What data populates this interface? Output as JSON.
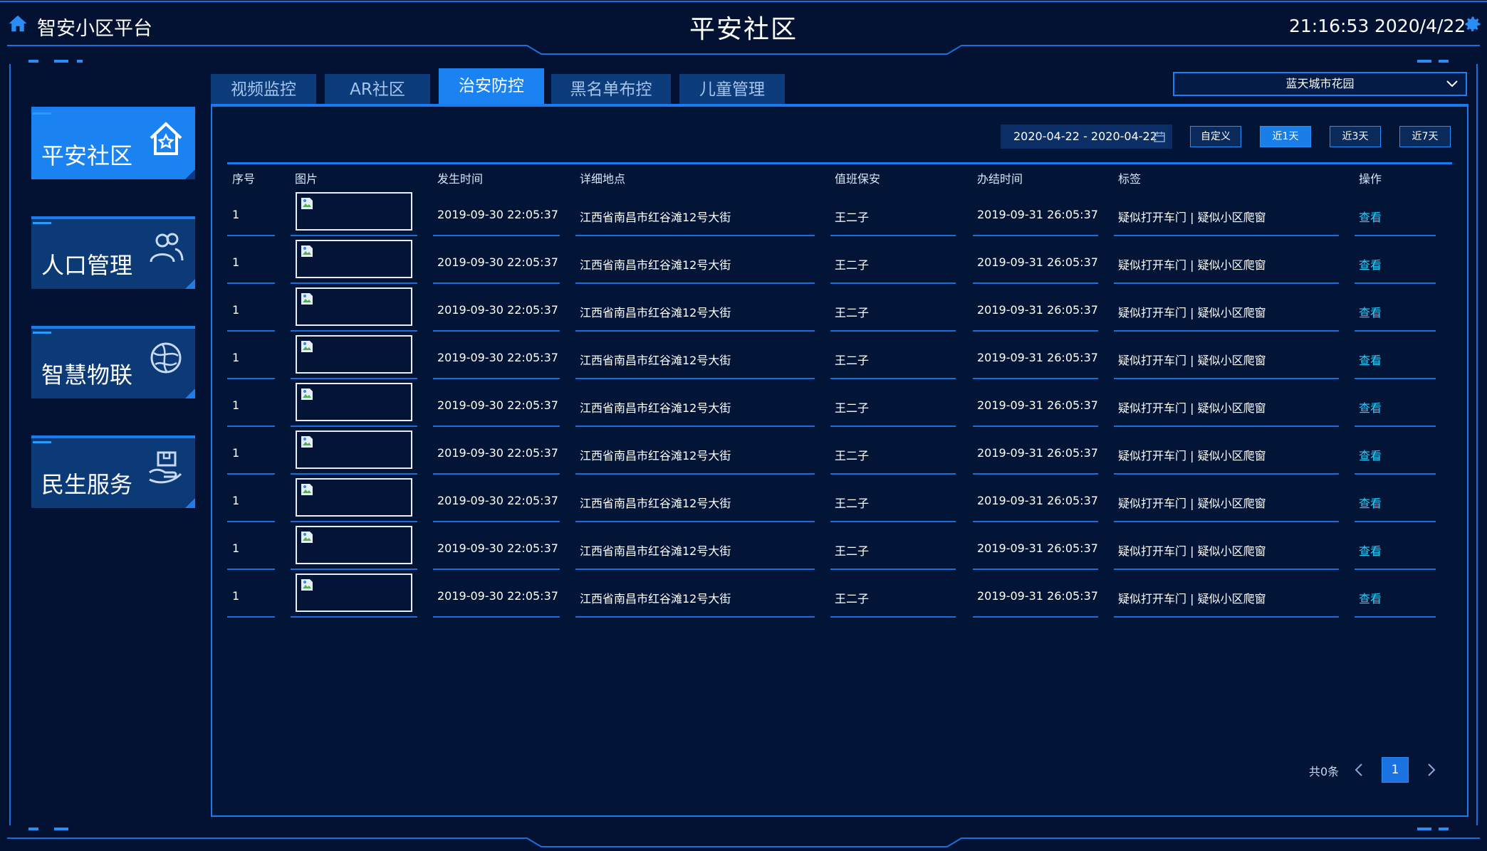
{
  "header": {
    "app_title": "智安小区平台",
    "center_title": "平安社区",
    "time": "21:16:53",
    "date": "2020/4/22"
  },
  "sidebar": {
    "items": [
      {
        "label": "平安社区",
        "icon": "house-star-icon",
        "active": true
      },
      {
        "label": "人口管理",
        "icon": "users-icon",
        "active": false
      },
      {
        "label": "智慧物联",
        "icon": "globe-icon",
        "active": false
      },
      {
        "label": "民生服务",
        "icon": "hand-box-icon",
        "active": false
      }
    ]
  },
  "tabs": [
    {
      "label": "视频监控",
      "active": false
    },
    {
      "label": "AR社区",
      "active": false
    },
    {
      "label": "治安防控",
      "active": true
    },
    {
      "label": "黑名单布控",
      "active": false
    },
    {
      "label": "儿童管理",
      "active": false
    }
  ],
  "community_select": {
    "value": "蓝天城市花园"
  },
  "filters": {
    "date_range": "2020-04-22 - 2020-04-22",
    "buttons": [
      {
        "label": "自定义",
        "active": false
      },
      {
        "label": "近1天",
        "active": true
      },
      {
        "label": "近3天",
        "active": false
      },
      {
        "label": "近7天",
        "active": false
      }
    ]
  },
  "table": {
    "headers": [
      "序号",
      "图片",
      "发生时间",
      "详细地点",
      "值班保安",
      "办结时间",
      "标签",
      "操作"
    ],
    "rows": [
      {
        "no": "1",
        "occur": "2019-09-30 22:05:37",
        "place": "江西省南昌市红谷滩12号大街",
        "guard": "王二子",
        "done": "2019-09-31 26:05:37",
        "tag": "疑似打开车门 | 疑似小区爬窗",
        "action": "查看"
      },
      {
        "no": "1",
        "occur": "2019-09-30 22:05:37",
        "place": "江西省南昌市红谷滩12号大街",
        "guard": "王二子",
        "done": "2019-09-31 26:05:37",
        "tag": "疑似打开车门 | 疑似小区爬窗",
        "action": "查看"
      },
      {
        "no": "1",
        "occur": "2019-09-30 22:05:37",
        "place": "江西省南昌市红谷滩12号大街",
        "guard": "王二子",
        "done": "2019-09-31 26:05:37",
        "tag": "疑似打开车门 | 疑似小区爬窗",
        "action": "查看"
      },
      {
        "no": "1",
        "occur": "2019-09-30 22:05:37",
        "place": "江西省南昌市红谷滩12号大街",
        "guard": "王二子",
        "done": "2019-09-31 26:05:37",
        "tag": "疑似打开车门 | 疑似小区爬窗",
        "action": "查看"
      },
      {
        "no": "1",
        "occur": "2019-09-30 22:05:37",
        "place": "江西省南昌市红谷滩12号大街",
        "guard": "王二子",
        "done": "2019-09-31 26:05:37",
        "tag": "疑似打开车门 | 疑似小区爬窗",
        "action": "查看"
      },
      {
        "no": "1",
        "occur": "2019-09-30 22:05:37",
        "place": "江西省南昌市红谷滩12号大街",
        "guard": "王二子",
        "done": "2019-09-31 26:05:37",
        "tag": "疑似打开车门 | 疑似小区爬窗",
        "action": "查看"
      },
      {
        "no": "1",
        "occur": "2019-09-30 22:05:37",
        "place": "江西省南昌市红谷滩12号大街",
        "guard": "王二子",
        "done": "2019-09-31 26:05:37",
        "tag": "疑似打开车门 | 疑似小区爬窗",
        "action": "查看"
      },
      {
        "no": "1",
        "occur": "2019-09-30 22:05:37",
        "place": "江西省南昌市红谷滩12号大街",
        "guard": "王二子",
        "done": "2019-09-31 26:05:37",
        "tag": "疑似打开车门 | 疑似小区爬窗",
        "action": "查看"
      },
      {
        "no": "1",
        "occur": "2019-09-30 22:05:37",
        "place": "江西省南昌市红谷滩12号大街",
        "guard": "王二子",
        "done": "2019-09-31 26:05:37",
        "tag": "疑似打开车门 | 疑似小区爬窗",
        "action": "查看"
      }
    ]
  },
  "pagination": {
    "total": "共0条",
    "current": "1"
  },
  "colors": {
    "accent": "#1a82f1",
    "background": "#031233",
    "link": "#29d0ff"
  }
}
